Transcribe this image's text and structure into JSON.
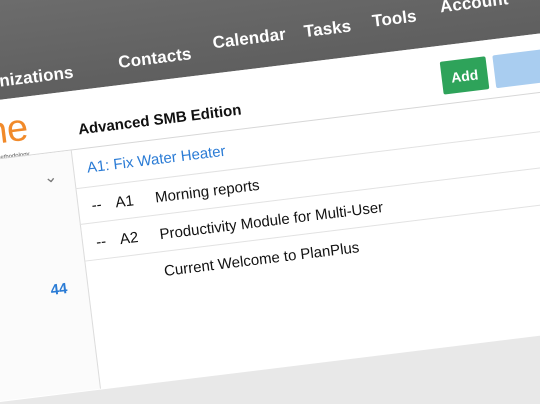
{
  "nav": {
    "items": [
      "anizations",
      "Contacts",
      "Calendar",
      "Tasks",
      "Tools",
      "Account"
    ]
  },
  "brand": {
    "logo_text": "nline",
    "tagline": "with Methodology",
    "edition": "Advanced SMB Edition"
  },
  "toolbar": {
    "add_label": "Add"
  },
  "sidebar": {
    "count": "44"
  },
  "task_group": {
    "title": "A1: Fix Water Heater",
    "rows": [
      {
        "dash": "--",
        "code": "A1",
        "label": "Morning reports"
      },
      {
        "dash": "--",
        "code": "A2",
        "label": "Productivity Module for Multi-User"
      },
      {
        "dash": "",
        "code": "",
        "label": "Current Welcome to PlanPlus"
      }
    ]
  },
  "icons": {
    "collapse": "chevron-down-icon"
  },
  "colors": {
    "nav_bg": "#666666",
    "brand_orange": "#f18a2a",
    "link_blue": "#2a7bd5",
    "add_green": "#2ea35a"
  }
}
